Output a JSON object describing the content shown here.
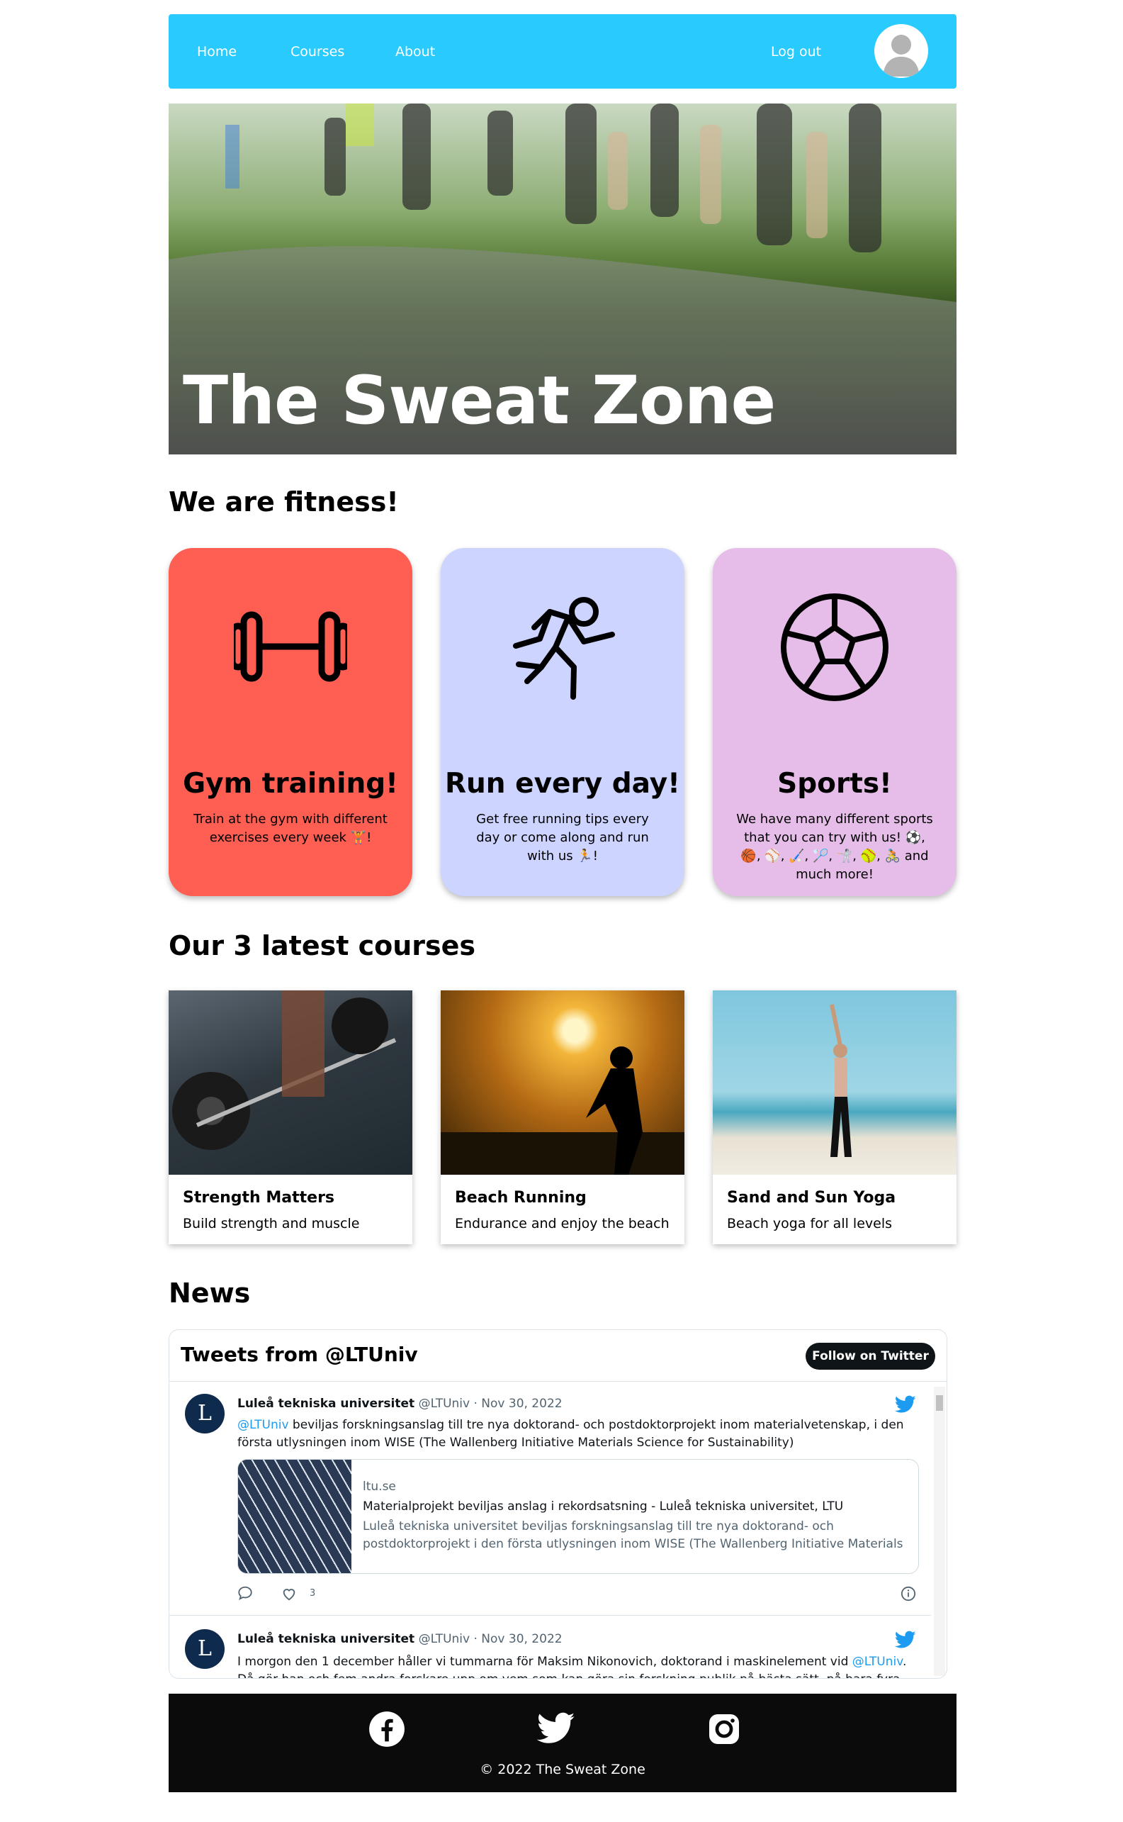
{
  "nav": {
    "home": "Home",
    "courses": "Courses",
    "about": "About",
    "logout": "Log out",
    "avatar_icon": "user-avatar-icon"
  },
  "hero": {
    "title": "The Sweat Zone"
  },
  "sections": {
    "fitness": "We are fitness!",
    "courses": "Our 3 latest courses",
    "news": "News"
  },
  "features": [
    {
      "title": "Gym training!",
      "text": "Train at the gym with different exercises every week 🏋️!",
      "icon": "dumbbell-icon",
      "color": "#ff5e53"
    },
    {
      "title": "Run every day!",
      "text": "Get free running tips every day or come along and run with us 🏃!",
      "icon": "runner-icon",
      "color": "#ccd4ff"
    },
    {
      "title": "Sports!",
      "text": "We have many different sports that you can try with us! ⚽, 🏀, ⚾, 🏑, 🏸, 🤺, 🥎, 🚴 and much more!",
      "icon": "soccer-ball-icon",
      "color": "#e6bde8"
    }
  ],
  "courses": [
    {
      "title": "Strength Matters",
      "subtitle": "Build strength and muscle"
    },
    {
      "title": "Beach Running",
      "subtitle": "Endurance and enjoy the beach"
    },
    {
      "title": "Sand and Sun Yoga",
      "subtitle": "Beach yoga for all levels"
    }
  ],
  "twitter": {
    "header": "Tweets from @LTUniv",
    "follow": "Follow on Twitter",
    "tweets": [
      {
        "name": "Luleå tekniska universitet",
        "handle": "@LTUniv · Nov 30, 2022",
        "mention": "@LTUniv",
        "text": "beviljas forskningsanslag till tre nya doktorand- och postdoktorprojekt inom materialvetenskap, i den första utlysningen inom WISE (The Wallenberg Initiative Materials Science for Sustainability)",
        "card_domain": "ltu.se",
        "card_title": "Materialprojekt beviljas anslag i rekordsatsning - Luleå tekniska universitet, LTU",
        "card_desc": "Luleå tekniska universitet beviljas forskningsanslag till tre nya doktorand- och postdoktorprojekt i den första utlysningen inom WISE (The Wallenberg Initiative Materials ...",
        "likes": "3"
      },
      {
        "name": "Luleå tekniska universitet",
        "handle": "@LTUniv · Nov 30, 2022",
        "text_a": "I morgon den 1 december håller vi tummarna för Maksim Nikonovich, doktorand i maskinelement vid",
        "mention": "@LTUniv",
        "text_b": ". Då gör han och fem andra forskare upp om vem som kan göra sin forskning publik på bästa sätt, på bara fyra minuter."
      }
    ]
  },
  "footer": {
    "copy": "© 2022 The Sweat Zone"
  }
}
